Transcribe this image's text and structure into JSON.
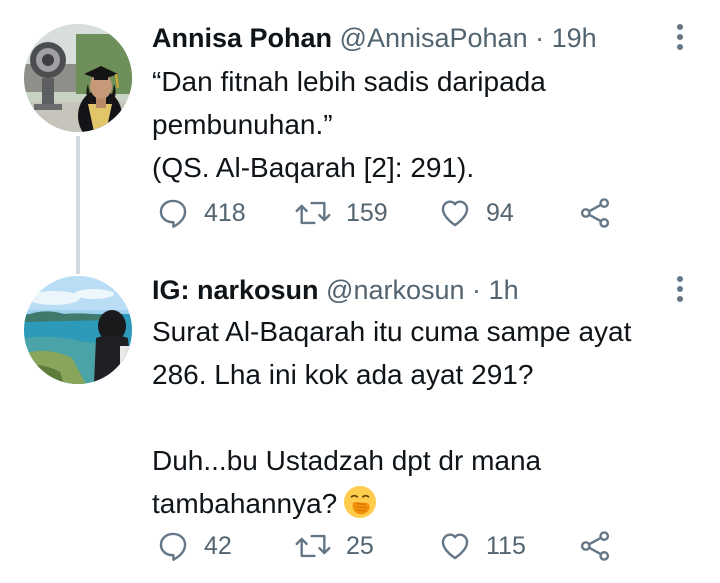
{
  "colors": {
    "text_primary": "#0f1419",
    "text_secondary": "#536471",
    "thread_line": "#cfd9de",
    "background": "#ffffff"
  },
  "tweets": [
    {
      "name": "Annisa Pohan",
      "handle": "@AnnisaPohan",
      "separator": "·",
      "time": "19h",
      "lines": [
        "“Dan fitnah lebih sadis daripada",
        "pembunuhan.”",
        "(QS. Al-Baqarah [2]: 291)."
      ],
      "stats": {
        "replies": "418",
        "retweets": "159",
        "likes": "94"
      },
      "avatar_icon": "graduation-photo-avatar"
    },
    {
      "name": "IG: narkosun",
      "handle": "@narkosun",
      "separator": "·",
      "time": "1h",
      "lines": [
        "Surat Al-Baqarah itu cuma sampe ayat",
        "286. Lha ini kok ada ayat 291?",
        "",
        "Duh...bu Ustadzah dpt dr mana",
        "tambahannya?"
      ],
      "emoji": "face-with-hand-over-mouth",
      "stats": {
        "replies": "42",
        "retweets": "25",
        "likes": "115"
      },
      "avatar_icon": "seaside-photo-avatar"
    }
  ]
}
